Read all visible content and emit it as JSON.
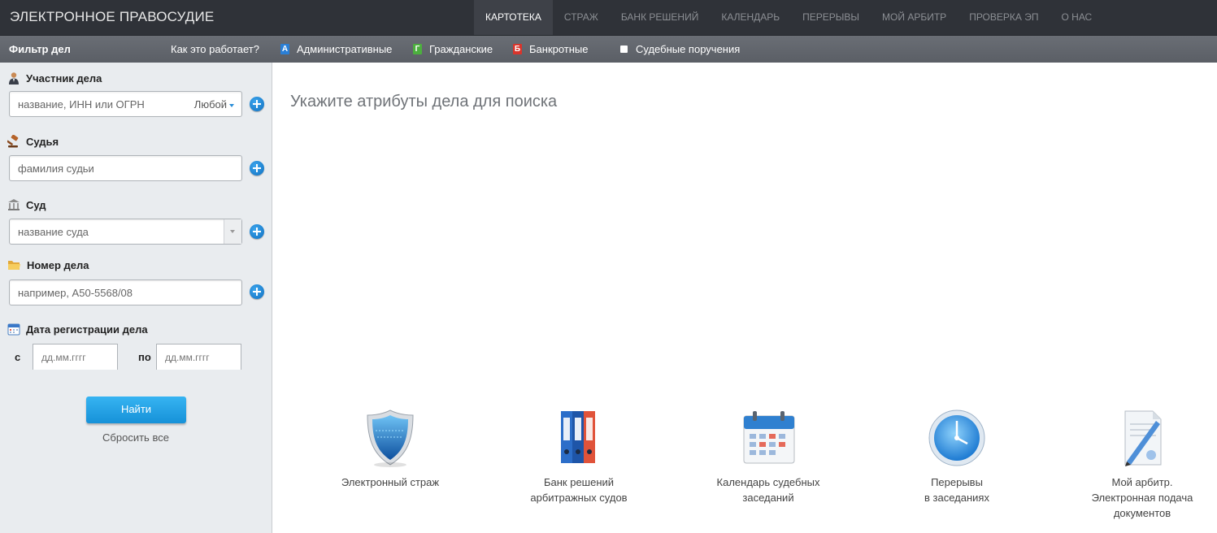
{
  "header": {
    "brand": "ЭЛЕКТРОННОЕ ПРАВОСУДИЕ",
    "nav": [
      "КАРТОТЕКА",
      "СТРАЖ",
      "БАНК РЕШЕНИЙ",
      "КАЛЕНДАРЬ",
      "ПЕРЕРЫВЫ",
      "МОЙ АРБИТР",
      "ПРОВЕРКА ЭП",
      "О НАС"
    ],
    "active_nav": "КАРТОТЕКА"
  },
  "subbar": {
    "filter_title": "Фильтр дел",
    "how_link": "Как это работает?",
    "categories": [
      {
        "badge": "А",
        "label": "Административные",
        "color": "#2a7fd6"
      },
      {
        "badge": "Г",
        "label": "Гражданские",
        "color": "#4caf3e"
      },
      {
        "badge": "Б",
        "label": "Банкротные",
        "color": "#d9342b"
      },
      {
        "badge": "",
        "label": "Судебные поручения",
        "color": "#ffffff"
      }
    ]
  },
  "filter": {
    "participant": {
      "label": "Участник дела",
      "placeholder": "название, ИНН или ОГРН",
      "role": "Любой"
    },
    "judge": {
      "label": "Судья",
      "placeholder": "фамилия судьи"
    },
    "court": {
      "label": "Суд",
      "placeholder": "название суда"
    },
    "case_number": {
      "label": "Номер дела",
      "placeholder": "например, А50-5568/08"
    },
    "date": {
      "label": "Дата регистрации дела",
      "from_label": "с",
      "to_label": "по",
      "from_placeholder": "дд.мм.гггг",
      "to_placeholder": "дд.мм.гггг"
    },
    "find_button": "Найти",
    "reset_link": "Сбросить все"
  },
  "main": {
    "prompt": "Укажите атрибуты дела для поиска",
    "services": [
      {
        "lines": [
          "Электронный страж"
        ],
        "icon": "shield-icon"
      },
      {
        "lines": [
          "Банк решений",
          "арбитражных судов"
        ],
        "icon": "binders-icon"
      },
      {
        "lines": [
          "Календарь судебных",
          "заседаний"
        ],
        "icon": "calendar-icon"
      },
      {
        "lines": [
          "Перерывы",
          "в заседаниях"
        ],
        "icon": "clock-icon"
      },
      {
        "lines": [
          "Мой арбитр.",
          "Электронная подача",
          "документов"
        ],
        "icon": "document-pen-icon"
      }
    ]
  }
}
